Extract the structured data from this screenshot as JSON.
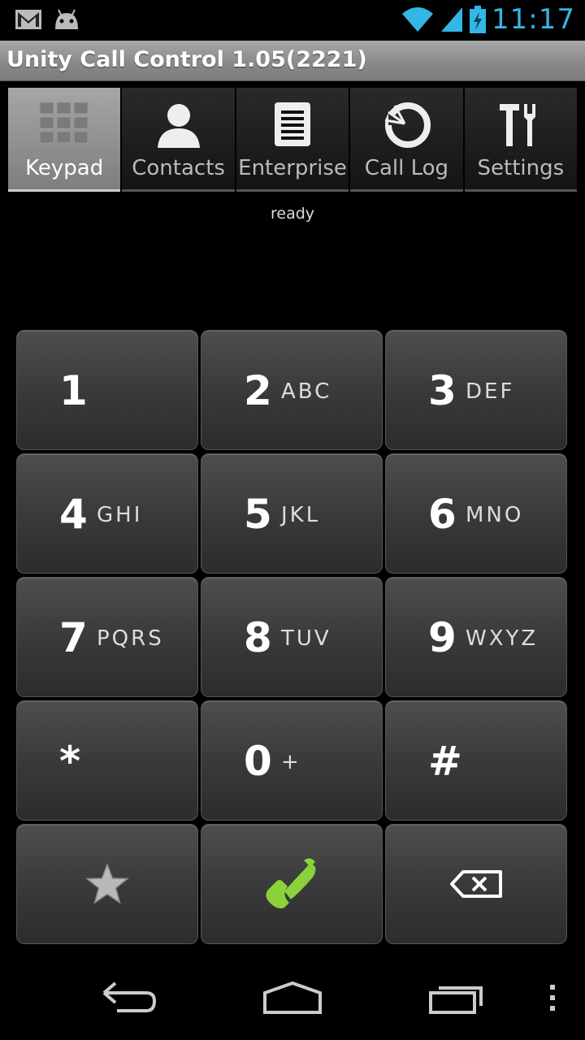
{
  "status_bar": {
    "time": "11:17",
    "icons": [
      "gmail-icon",
      "android-icon",
      "wifi-icon",
      "signal-icon",
      "battery-charging-icon"
    ],
    "accent_color": "#33b5e5"
  },
  "app": {
    "title": "Unity Call Control 1.05(2221)"
  },
  "tabs": [
    {
      "label": "Keypad",
      "icon": "keypad-grid-icon",
      "active": true
    },
    {
      "label": "Contacts",
      "icon": "person-icon",
      "active": false
    },
    {
      "label": "Enterprise",
      "icon": "document-list-icon",
      "active": false
    },
    {
      "label": "Call Log",
      "icon": "call-log-icon",
      "active": false
    },
    {
      "label": "Settings",
      "icon": "tools-icon",
      "active": false
    }
  ],
  "status_text": "ready",
  "keypad": {
    "keys": [
      {
        "digit": "1",
        "letters": ""
      },
      {
        "digit": "2",
        "letters": "ABC"
      },
      {
        "digit": "3",
        "letters": "DEF"
      },
      {
        "digit": "4",
        "letters": "GHI"
      },
      {
        "digit": "5",
        "letters": "JKL"
      },
      {
        "digit": "6",
        "letters": "MNO"
      },
      {
        "digit": "7",
        "letters": "PQRS"
      },
      {
        "digit": "8",
        "letters": "TUV"
      },
      {
        "digit": "9",
        "letters": "WXYZ"
      },
      {
        "digit": "*",
        "letters": ""
      },
      {
        "digit": "0",
        "letters": "+"
      },
      {
        "digit": "#",
        "letters": ""
      }
    ],
    "actions": [
      "favorite-star-icon",
      "call-icon",
      "backspace-icon"
    ],
    "call_color": "#8bd13a"
  },
  "nav": [
    "back-icon",
    "home-icon",
    "recent-apps-icon",
    "overflow-menu-icon"
  ]
}
